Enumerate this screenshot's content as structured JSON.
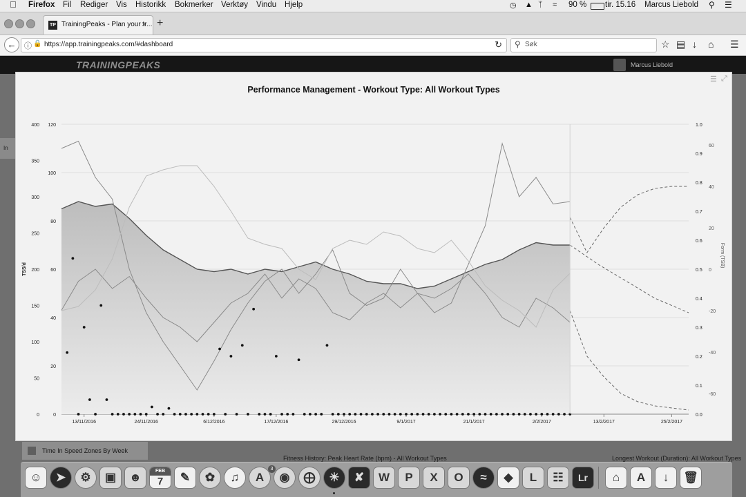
{
  "menubar": {
    "apple": "",
    "app": "Firefox",
    "items": [
      "Fil",
      "Rediger",
      "Vis",
      "Historikk",
      "Bokmerker",
      "Verktøy",
      "Vindu",
      "Hjelp"
    ],
    "battery": "90 %",
    "clock": "tir. 15.16",
    "user": "Marcus Liebold"
  },
  "browser": {
    "tab_title": "TrainingPeaks - Plan your tr...",
    "tab_favicon": "TP",
    "url": "https://app.trainingpeaks.com/#dashboard",
    "search_placeholder": "Søk"
  },
  "tp": {
    "logo": "TRAININGPEAKS",
    "user": "Marcus Liebold"
  },
  "dashboard": {
    "speed_tile": "Time In Speed Zones By Week",
    "fitness_history_title": "Fitness History: Peak Heart Rate (bpm) - All Workout Types",
    "longest_workout_title": "Longest Workout (Duration): All Workout Types",
    "side_fragment": "In"
  },
  "dock": {
    "calendar_month": "FEB",
    "calendar_day": "7",
    "appstore_badge": "3",
    "lightroom": "Lr"
  },
  "chart_data": {
    "type": "line",
    "title": "Performance Management - Workout Type: All Workout Types",
    "x_tick_labels": [
      "13/11/2016",
      "24/11/2016",
      "6/12/2016",
      "17/12/2016",
      "29/12/2016",
      "9/1/2017",
      "21/1/2017",
      "2/2/2017",
      "13/2/2017",
      "25/2/2017"
    ],
    "x_start": "2016-11-09",
    "x_end": "2017-02-28",
    "today": "2017-02-07",
    "axes": {
      "tss": {
        "label": "TSS/d",
        "ticks": [
          "0",
          "50",
          "100",
          "150",
          "200",
          "250",
          "300",
          "350",
          "400"
        ],
        "range": [
          0,
          400
        ]
      },
      "fitness": {
        "label": "",
        "ticks": [
          "0",
          "20",
          "40",
          "60",
          "80",
          "100",
          "120"
        ],
        "range": [
          0,
          120
        ]
      },
      "if": {
        "label": "",
        "ticks": [
          "0.0",
          "0.1",
          "0.2",
          "0.3",
          "0.4",
          "0.5",
          "0.6",
          "0.7",
          "0.8",
          "0.9",
          "1.0"
        ],
        "range": [
          0,
          1
        ]
      },
      "form": {
        "label": "Form (TSB)",
        "ticks": [
          "-60",
          "-40",
          "-20",
          "0",
          "20",
          "40",
          "60"
        ],
        "range": [
          -70,
          70
        ]
      }
    },
    "grid": true,
    "series": [
      {
        "name": "",
        "kind": "area",
        "axis": "fitness",
        "x": [
          "2016-11-09",
          "2016-11-12",
          "2016-11-15",
          "2016-11-18",
          "2016-11-21",
          "2016-11-24",
          "2016-11-27",
          "2016-11-30",
          "2016-12-03",
          "2016-12-06",
          "2016-12-09",
          "2016-12-12",
          "2016-12-15",
          "2016-12-18",
          "2016-12-21",
          "2016-12-24",
          "2016-12-27",
          "2016-12-30",
          "2017-01-02",
          "2017-01-05",
          "2017-01-08",
          "2017-01-11",
          "2017-01-14",
          "2017-01-17",
          "2017-01-20",
          "2017-01-23",
          "2017-01-26",
          "2017-01-29",
          "2017-02-01",
          "2017-02-04",
          "2017-02-07"
        ],
        "y": [
          85,
          88,
          86,
          87,
          81,
          74,
          68,
          64,
          60,
          59,
          60,
          58,
          60,
          59,
          61,
          63,
          60,
          58,
          55,
          54,
          54,
          52,
          53,
          56,
          59,
          62,
          64,
          68,
          71,
          70,
          70
        ]
      },
      {
        "name": "",
        "kind": "line",
        "axis": "fitness",
        "x": [
          "2016-11-09",
          "2016-11-12",
          "2016-11-15",
          "2016-11-18",
          "2016-11-21",
          "2016-11-24",
          "2016-11-27",
          "2016-11-30",
          "2016-12-03",
          "2016-12-06",
          "2016-12-09",
          "2016-12-12",
          "2016-12-15",
          "2016-12-18",
          "2016-12-21",
          "2016-12-24",
          "2016-12-27",
          "2016-12-30",
          "2017-01-02",
          "2017-01-05",
          "2017-01-08",
          "2017-01-11",
          "2017-01-14",
          "2017-01-17",
          "2017-01-20",
          "2017-01-23",
          "2017-01-26",
          "2017-01-29",
          "2017-02-01",
          "2017-02-04",
          "2017-02-07"
        ],
        "y": [
          43,
          55,
          60,
          52,
          57,
          48,
          40,
          36,
          30,
          38,
          46,
          50,
          58,
          48,
          56,
          52,
          42,
          39,
          46,
          50,
          44,
          50,
          48,
          52,
          58,
          50,
          40,
          36,
          48,
          44,
          38
        ]
      },
      {
        "name": "",
        "kind": "line",
        "axis": "fitness",
        "x": [
          "2016-11-09",
          "2016-11-12",
          "2016-11-15",
          "2016-11-18",
          "2016-11-21",
          "2016-11-24",
          "2016-11-27",
          "2016-11-30",
          "2016-12-03",
          "2016-12-06",
          "2016-12-09",
          "2016-12-12",
          "2016-12-15",
          "2016-12-18",
          "2016-12-21",
          "2016-12-24",
          "2016-12-27",
          "2016-12-30",
          "2017-01-02",
          "2017-01-05",
          "2017-01-08",
          "2017-01-11",
          "2017-01-14",
          "2017-01-17",
          "2017-01-20",
          "2017-01-23",
          "2017-01-26",
          "2017-01-29",
          "2017-02-01",
          "2017-02-04",
          "2017-02-07"
        ],
        "y": [
          110,
          113,
          98,
          89,
          60,
          42,
          30,
          20,
          10,
          22,
          35,
          46,
          55,
          60,
          50,
          58,
          68,
          50,
          45,
          48,
          60,
          50,
          42,
          46,
          62,
          78,
          112,
          90,
          98,
          87,
          88
        ]
      },
      {
        "name": "",
        "kind": "dashed",
        "axis": "fitness",
        "x": [
          "2017-02-07",
          "2017-02-12",
          "2017-02-17",
          "2017-02-22",
          "2017-02-28"
        ],
        "y": [
          70,
          62,
          55,
          48,
          42
        ]
      },
      {
        "name": "",
        "kind": "dashed",
        "axis": "form",
        "x": [
          "2017-02-07",
          "2017-02-10",
          "2017-02-13",
          "2017-02-16",
          "2017-02-19",
          "2017-02-22",
          "2017-02-25",
          "2017-02-28"
        ],
        "y": [
          -20,
          -42,
          -52,
          -60,
          -64,
          -66,
          -67,
          -68
        ]
      },
      {
        "name": "",
        "kind": "dashed",
        "axis": "form",
        "x": [
          "2017-02-07",
          "2017-02-10",
          "2017-02-13",
          "2017-02-16",
          "2017-02-19",
          "2017-02-22",
          "2017-02-25",
          "2017-02-28"
        ],
        "y": [
          25,
          8,
          20,
          30,
          36,
          39,
          40,
          40
        ]
      },
      {
        "name": "",
        "kind": "light",
        "axis": "form",
        "x": [
          "2016-11-09",
          "2016-11-12",
          "2016-11-15",
          "2016-11-18",
          "2016-11-21",
          "2016-11-24",
          "2016-11-27",
          "2016-11-30",
          "2016-12-03",
          "2016-12-06",
          "2016-12-09",
          "2016-12-12",
          "2016-12-15",
          "2016-12-18",
          "2016-12-21",
          "2016-12-24",
          "2016-12-27",
          "2016-12-30",
          "2017-01-02",
          "2017-01-05",
          "2017-01-08",
          "2017-01-11",
          "2017-01-14",
          "2017-01-17",
          "2017-01-20",
          "2017-01-23",
          "2017-01-26",
          "2017-01-29",
          "2017-02-01",
          "2017-02-04",
          "2017-02-07"
        ],
        "y": [
          -20,
          -18,
          -10,
          5,
          30,
          45,
          48,
          50,
          50,
          40,
          28,
          15,
          12,
          10,
          0,
          -5,
          10,
          14,
          12,
          18,
          16,
          10,
          8,
          14,
          4,
          -8,
          -15,
          -20,
          -28,
          -10,
          -2
        ]
      }
    ],
    "points_tss": {
      "x": [
        "2016-11-10",
        "2016-11-11",
        "2016-11-12",
        "2016-11-13",
        "2016-11-14",
        "2016-11-15",
        "2016-11-16",
        "2016-11-17",
        "2016-11-18",
        "2016-11-19",
        "2016-11-20",
        "2016-11-21",
        "2016-11-22",
        "2016-11-23",
        "2016-11-24",
        "2016-11-25",
        "2016-11-26",
        "2016-11-27",
        "2016-11-28",
        "2016-11-29",
        "2016-11-30",
        "2016-12-01",
        "2016-12-02",
        "2016-12-03",
        "2016-12-04",
        "2016-12-05",
        "2016-12-06",
        "2016-12-07",
        "2016-12-08",
        "2016-12-09",
        "2016-12-10",
        "2016-12-11",
        "2016-12-12",
        "2016-12-13",
        "2016-12-14",
        "2016-12-15",
        "2016-12-16",
        "2016-12-17",
        "2016-12-18",
        "2016-12-19",
        "2016-12-20",
        "2016-12-21",
        "2016-12-22",
        "2016-12-23",
        "2016-12-24",
        "2016-12-25",
        "2016-12-26",
        "2016-12-27",
        "2016-12-28",
        "2016-12-29",
        "2016-12-30",
        "2016-12-31",
        "2017-01-01",
        "2017-01-02",
        "2017-01-03",
        "2017-01-04",
        "2017-01-05",
        "2017-01-06",
        "2017-01-07",
        "2017-01-08",
        "2017-01-09",
        "2017-01-10",
        "2017-01-11",
        "2017-01-12",
        "2017-01-13",
        "2017-01-14",
        "2017-01-15",
        "2017-01-16",
        "2017-01-17",
        "2017-01-18",
        "2017-01-19",
        "2017-01-20",
        "2017-01-21",
        "2017-01-22",
        "2017-01-23",
        "2017-01-24",
        "2017-01-25",
        "2017-01-26",
        "2017-01-27",
        "2017-01-28",
        "2017-01-29",
        "2017-01-30",
        "2017-01-31",
        "2017-02-01",
        "2017-02-02",
        "2017-02-03",
        "2017-02-04",
        "2017-02-05",
        "2017-02-06",
        "2017-02-07"
      ],
      "y": [
        85,
        215,
        0,
        120,
        20,
        0,
        150,
        20,
        0,
        0,
        0,
        0,
        0,
        0,
        0,
        10,
        0,
        0,
        8,
        0,
        0,
        0,
        0,
        0,
        0,
        0,
        0,
        90,
        0,
        80,
        0,
        95,
        0,
        145,
        0,
        0,
        0,
        80,
        0,
        0,
        0,
        75,
        0,
        0,
        0,
        0,
        95,
        0,
        0,
        0,
        0,
        0,
        0,
        0,
        0,
        0,
        0,
        0,
        0,
        0,
        0,
        0,
        0,
        0,
        0,
        0,
        0,
        0,
        0,
        0,
        0,
        0,
        0,
        0,
        0,
        0,
        0,
        0,
        0,
        0,
        0,
        0,
        0,
        0,
        0,
        0,
        0,
        0,
        0,
        0
      ]
    }
  }
}
